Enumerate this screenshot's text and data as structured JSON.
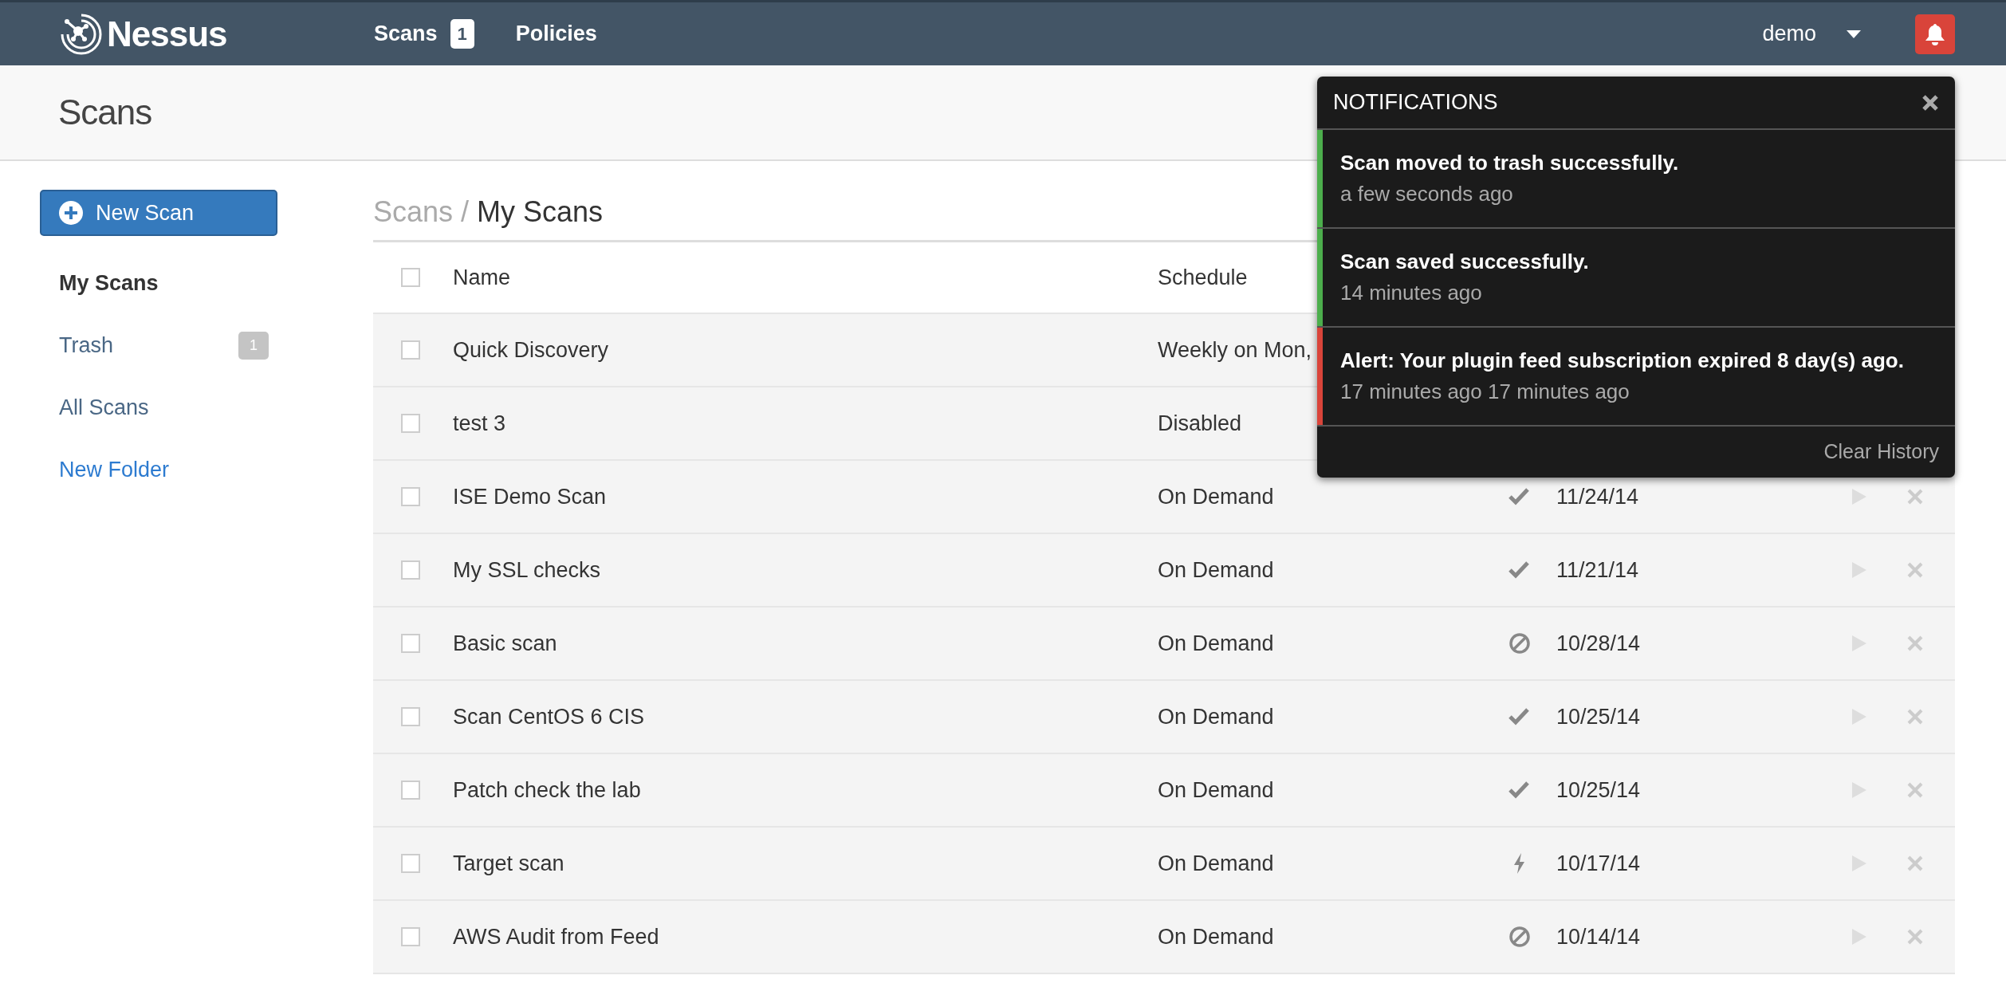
{
  "navbar": {
    "brand": "Nessus",
    "links": [
      {
        "label": "Scans",
        "badge": "1"
      },
      {
        "label": "Policies"
      }
    ],
    "user": "demo"
  },
  "page_header": {
    "title": "Scans"
  },
  "sidebar": {
    "new_scan_button": "New Scan",
    "items": [
      {
        "label": "My Scans",
        "selected": true
      },
      {
        "label": "Trash",
        "badge": "1",
        "selected": false
      },
      {
        "label": "All Scans",
        "selected": false
      }
    ],
    "new_folder_link": "New Folder"
  },
  "breadcrumb": {
    "parent": "Scans",
    "separator": "/",
    "current": "My Scans"
  },
  "table": {
    "select_all_checked": false,
    "columns": [
      "Name",
      "Schedule"
    ],
    "rows": [
      {
        "name": "Quick Discovery",
        "schedule": "Weekly on Mon,",
        "checked": false
      },
      {
        "name": "test 3",
        "schedule": "Disabled",
        "checked": false
      },
      {
        "name": "ISE Demo Scan",
        "schedule": "On Demand",
        "kind": "completed",
        "last_scan": "11/24/14",
        "checked": false
      },
      {
        "name": "My SSL checks",
        "schedule": "On Demand",
        "kind": "completed",
        "last_scan": "11/21/14",
        "checked": false
      },
      {
        "name": "Basic scan",
        "schedule": "On Demand",
        "kind": "canceled",
        "last_scan": "10/28/14",
        "checked": false
      },
      {
        "name": "Scan CentOS 6 CIS",
        "schedule": "On Demand",
        "kind": "completed",
        "last_scan": "10/25/14",
        "checked": false
      },
      {
        "name": "Patch check the lab",
        "schedule": "On Demand",
        "kind": "completed",
        "last_scan": "10/25/14",
        "checked": false
      },
      {
        "name": "Target scan",
        "schedule": "On Demand",
        "kind": "imported",
        "last_scan": "10/17/14",
        "checked": false
      },
      {
        "name": "AWS Audit from Feed",
        "schedule": "On Demand",
        "kind": "canceled",
        "last_scan": "10/14/14",
        "checked": false
      }
    ]
  },
  "notifications": {
    "title": "NOTIFICATIONS",
    "items": [
      {
        "message": "Scan moved to trash successfully.",
        "time": "a few seconds ago",
        "color": "#4cae4c"
      },
      {
        "message": "Scan saved successfully.",
        "time": "14 minutes ago",
        "color": "#4cae4c"
      },
      {
        "message": "Alert: Your plugin feed subscription expired 8 day(s) ago.",
        "time": "17 minutes ago 17 minutes ago",
        "color": "#d9443a"
      }
    ],
    "footer_link": "Clear History"
  }
}
